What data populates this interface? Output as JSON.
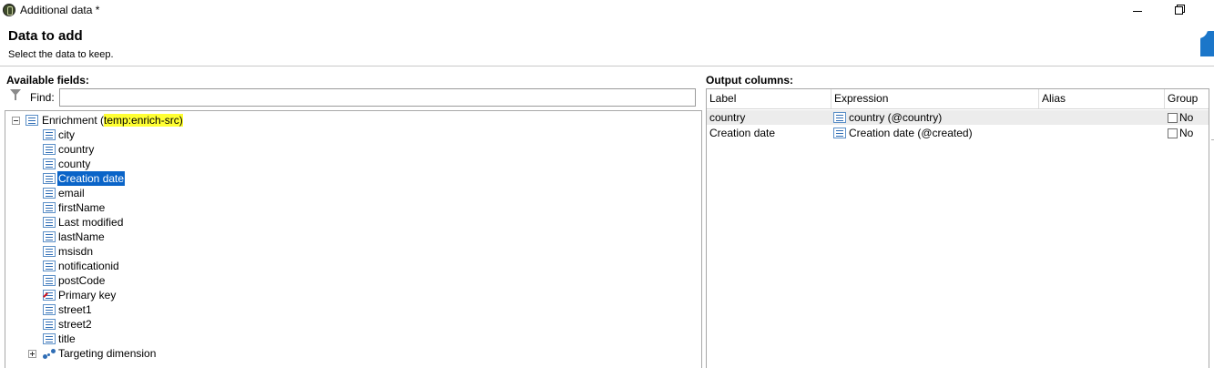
{
  "window": {
    "title": "Additional data *",
    "controls": [
      "minimize-icon",
      "restore-icon"
    ]
  },
  "header": {
    "title": "Data to add",
    "subtitle": "Select the data to keep."
  },
  "left": {
    "label": "Available fields:",
    "find_label": "Find:",
    "find_value": "",
    "root": {
      "label": "Enrichment (",
      "highlight": "temp:enrich-src)",
      "expanded": true
    },
    "fields": [
      {
        "label": "city",
        "icon": "list-icon"
      },
      {
        "label": "country",
        "icon": "list-icon"
      },
      {
        "label": "county",
        "icon": "list-icon"
      },
      {
        "label": "Creation date",
        "icon": "list-icon",
        "selected": true
      },
      {
        "label": "email",
        "icon": "list-icon"
      },
      {
        "label": "firstName",
        "icon": "list-icon"
      },
      {
        "label": "Last modified",
        "icon": "list-icon"
      },
      {
        "label": "lastName",
        "icon": "list-icon"
      },
      {
        "label": "msisdn",
        "icon": "list-icon"
      },
      {
        "label": "notificationid",
        "icon": "list-icon"
      },
      {
        "label": "postCode",
        "icon": "list-icon"
      },
      {
        "label": "Primary key",
        "icon": "key-icon"
      },
      {
        "label": "street1",
        "icon": "list-icon"
      },
      {
        "label": "street2",
        "icon": "list-icon"
      },
      {
        "label": "title",
        "icon": "list-icon"
      }
    ],
    "link": {
      "label": "Targeting dimension",
      "icon": "link-icon",
      "expanded": false
    }
  },
  "right": {
    "label": "Output columns:",
    "columns": [
      "Label",
      "Expression",
      "Alias",
      "Group"
    ],
    "rows": [
      {
        "label": "country",
        "expression": "country (@country)",
        "alias": "",
        "group": "No",
        "checked": false
      },
      {
        "label": "Creation date",
        "expression": "Creation date (@created)",
        "alias": "",
        "group": "No",
        "checked": false
      }
    ]
  },
  "colors": {
    "selection": "#0a64c8",
    "highlight": "#ffff33",
    "accent": "#1b76c9"
  }
}
